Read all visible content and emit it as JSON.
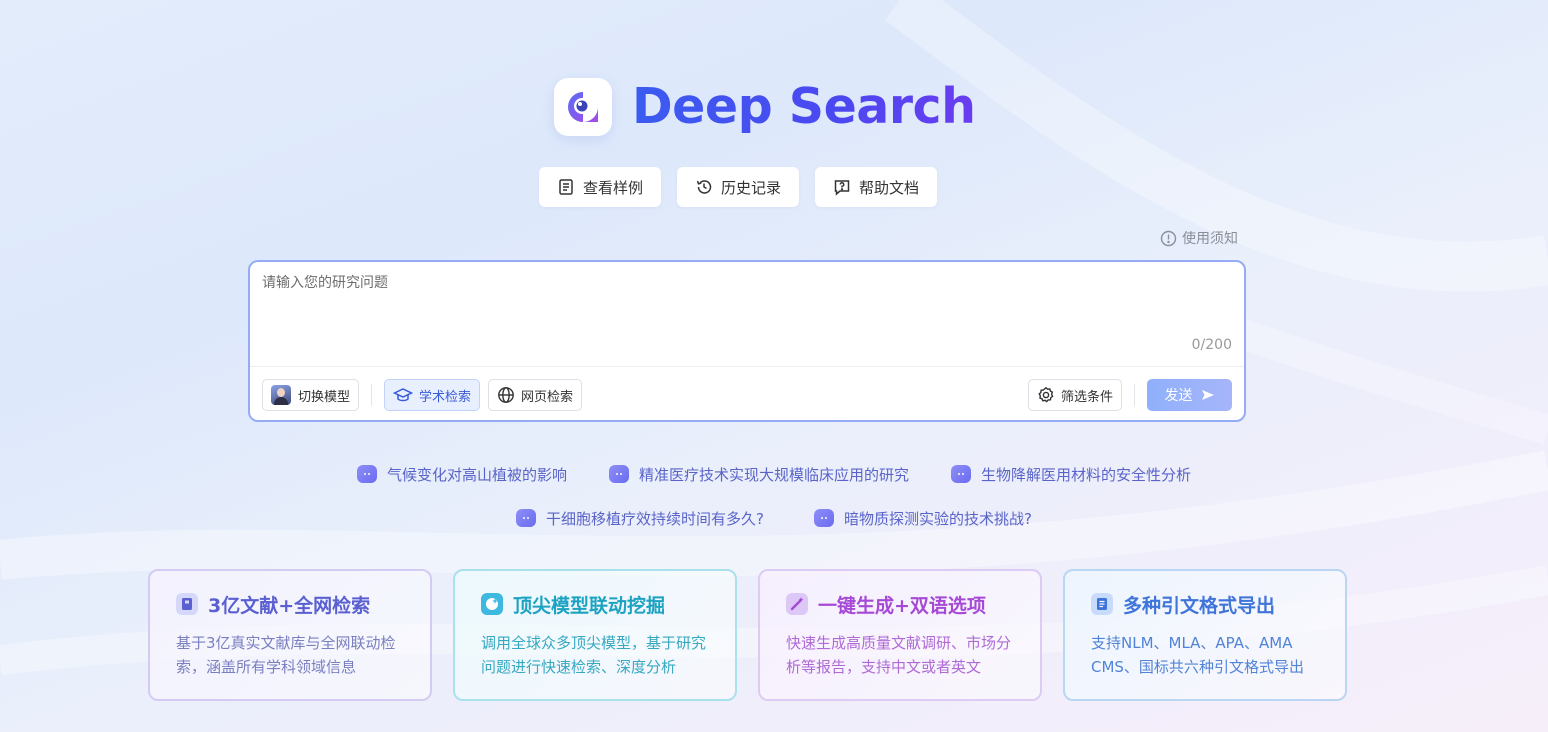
{
  "brand": {
    "title": "Deep Search",
    "logo_icon": "magnifier-eye-icon"
  },
  "top_buttons": [
    {
      "label": "查看样例",
      "icon": "document-icon"
    },
    {
      "label": "历史记录",
      "icon": "history-icon"
    },
    {
      "label": "帮助文档",
      "icon": "help-icon"
    }
  ],
  "notice": {
    "label": "使用须知",
    "icon": "info-circle-icon"
  },
  "input": {
    "placeholder": "请输入您的研究问题",
    "value": "",
    "counter": "0/200"
  },
  "toolbar": {
    "switch_model": "切换模型",
    "academic_search": "学术检索",
    "web_search": "网页检索",
    "filter": "筛选条件",
    "send": "发送",
    "active_mode": "学术检索"
  },
  "suggestions": [
    "气候变化对高山植被的影响",
    "精准医疗技术实现大规模临床应用的研究",
    "生物降解医用材料的安全性分析",
    "干细胞移植疗效持续时间有多久?",
    "暗物质探测实验的技术挑战?"
  ],
  "features": [
    {
      "title": "3亿文献+全网检索",
      "desc": "基于3亿真实文献库与全网联动检索，涵盖所有学科领域信息",
      "icon": "book-icon"
    },
    {
      "title": "顶尖模型联动挖掘",
      "desc": "调用全球众多顶尖模型，基于研究问题进行快速检索、深度分析",
      "icon": "sparkle-bubble-icon"
    },
    {
      "title": "一键生成+双语选项",
      "desc": "快速生成高质量文献调研、市场分析等报告，支持中文或者英文",
      "icon": "magic-wand-icon"
    },
    {
      "title": "多种引文格式导出",
      "desc": "支持NLM、MLA、APA、AMA CMS、国标共六种引文格式导出",
      "icon": "list-document-icon"
    }
  ],
  "colors": {
    "brand_blue": "#3b5cf0",
    "brand_purple": "#6a3cf0",
    "send": "#8fb0fb",
    "suggestion": "#5a64c8"
  }
}
